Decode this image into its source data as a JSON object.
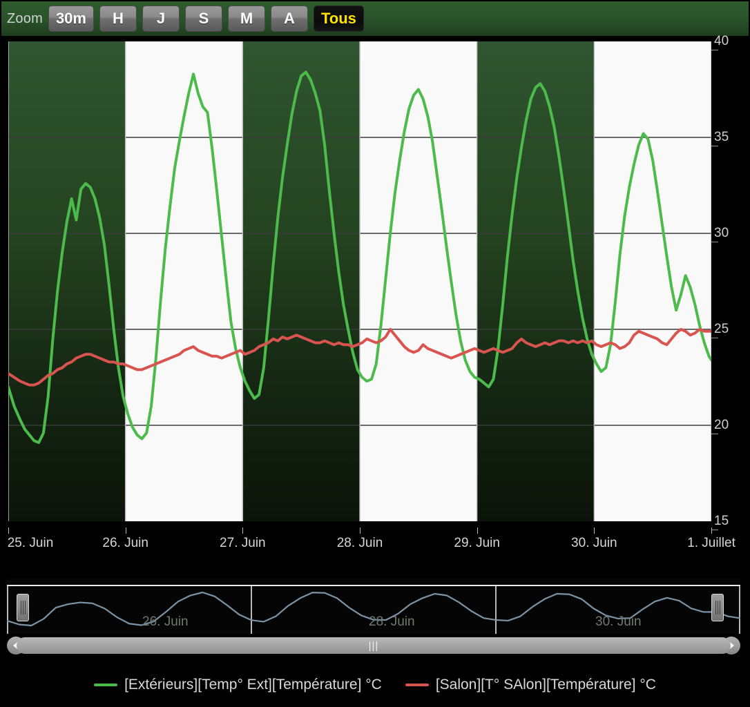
{
  "zoom_bar": {
    "label": "Zoom",
    "buttons": [
      {
        "label": "30m",
        "selected": false
      },
      {
        "label": "H",
        "selected": false
      },
      {
        "label": "J",
        "selected": false
      },
      {
        "label": "S",
        "selected": false
      },
      {
        "label": "M",
        "selected": false
      },
      {
        "label": "A",
        "selected": false
      },
      {
        "label": "Tous",
        "selected": true
      }
    ]
  },
  "navigator": {
    "dates": [
      "26. Juin",
      "28. Juin",
      "30. Juin"
    ],
    "scroll_grip": "|||",
    "left_arrow": "left-arrow-icon",
    "right_arrow": "right-arrow-icon"
  },
  "colors": {
    "series_green": "#4cbb4c",
    "series_red": "#d9534f",
    "band_dark": "#2f5630",
    "band_light": "#f9f9f9",
    "header_green": "#2f5c2f",
    "selected_text": "#ffe400",
    "background": "#000000",
    "navigator_line": "#7d94a6"
  },
  "legend": [
    {
      "label": "[Extérieurs][Temp° Ext][Température] °C",
      "color": "#4cbb4c"
    },
    {
      "label": "[Salon][T° SAlon][Température] °C",
      "color": "#d9534f"
    }
  ],
  "chart_data": {
    "type": "line",
    "title": "",
    "xlabel": "",
    "ylabel": "°C",
    "ylim": [
      15,
      40
    ],
    "yticks": [
      15,
      20,
      25,
      30,
      35,
      40
    ],
    "grid": true,
    "legend_position": "bottom",
    "x_tick_labels": [
      "25. Juin",
      "26. Juin",
      "27. Juin",
      "28. Juin",
      "29. Juin",
      "30. Juin",
      "1. Juillet"
    ],
    "x_range_days": [
      0,
      6
    ],
    "alternating_bands": true,
    "series": [
      {
        "name": "[Extérieurs][Temp° Ext][Température] °C",
        "color": "#4cbb4c",
        "unit": "°C",
        "x": [
          0.0,
          0.05,
          0.1,
          0.14,
          0.18,
          0.22,
          0.26,
          0.3,
          0.34,
          0.38,
          0.42,
          0.46,
          0.5,
          0.54,
          0.58,
          0.62,
          0.66,
          0.7,
          0.74,
          0.78,
          0.82,
          0.86,
          0.9,
          0.94,
          0.98,
          1.02,
          1.06,
          1.1,
          1.14,
          1.18,
          1.22,
          1.26,
          1.3,
          1.34,
          1.38,
          1.42,
          1.46,
          1.5,
          1.54,
          1.58,
          1.62,
          1.66,
          1.7,
          1.74,
          1.78,
          1.82,
          1.86,
          1.9,
          1.94,
          1.98,
          2.02,
          2.06,
          2.1,
          2.14,
          2.18,
          2.22,
          2.26,
          2.3,
          2.34,
          2.38,
          2.42,
          2.46,
          2.5,
          2.54,
          2.58,
          2.62,
          2.66,
          2.7,
          2.74,
          2.78,
          2.82,
          2.86,
          2.9,
          2.94,
          2.98,
          3.02,
          3.06,
          3.1,
          3.14,
          3.18,
          3.22,
          3.26,
          3.3,
          3.34,
          3.38,
          3.42,
          3.46,
          3.5,
          3.54,
          3.58,
          3.62,
          3.66,
          3.7,
          3.74,
          3.78,
          3.82,
          3.86,
          3.9,
          3.94,
          3.98,
          4.02,
          4.06,
          4.1,
          4.14,
          4.18,
          4.22,
          4.26,
          4.3,
          4.34,
          4.38,
          4.42,
          4.46,
          4.5,
          4.54,
          4.58,
          4.62,
          4.66,
          4.7,
          4.74,
          4.78,
          4.82,
          4.86,
          4.9,
          4.94,
          4.98,
          5.02,
          5.06,
          5.1,
          5.14,
          5.18,
          5.22,
          5.26,
          5.3,
          5.34,
          5.38,
          5.42,
          5.46,
          5.5,
          5.54,
          5.58,
          5.62,
          5.66,
          5.7,
          5.74,
          5.78,
          5.82,
          5.86,
          5.9,
          5.94,
          5.98,
          6.0
        ],
        "y": [
          22.0,
          21.0,
          20.3,
          19.8,
          19.5,
          19.2,
          19.1,
          19.6,
          21.5,
          24.5,
          27.0,
          29.0,
          30.6,
          31.8,
          30.7,
          32.3,
          32.6,
          32.4,
          31.8,
          30.8,
          29.4,
          27.3,
          25.0,
          23.0,
          21.5,
          20.6,
          19.9,
          19.5,
          19.3,
          19.6,
          21.0,
          23.5,
          26.5,
          29.2,
          31.4,
          33.4,
          34.8,
          36.1,
          37.3,
          38.3,
          37.3,
          36.6,
          36.3,
          34.4,
          32.2,
          29.9,
          27.6,
          25.4,
          24.0,
          23.0,
          22.3,
          21.8,
          21.4,
          21.6,
          23.0,
          25.5,
          28.3,
          30.8,
          32.9,
          34.6,
          36.2,
          37.4,
          38.2,
          38.4,
          38.0,
          37.3,
          36.4,
          34.6,
          32.2,
          30.0,
          28.0,
          26.3,
          25.0,
          23.8,
          22.9,
          22.5,
          22.3,
          22.4,
          23.2,
          25.2,
          27.6,
          30.0,
          32.1,
          33.8,
          35.3,
          36.5,
          37.2,
          37.5,
          37.0,
          36.1,
          34.8,
          33.0,
          31.2,
          29.3,
          27.5,
          25.8,
          24.4,
          23.4,
          22.8,
          22.5,
          22.4,
          22.2,
          22.0,
          22.4,
          24.0,
          26.3,
          28.8,
          31.0,
          32.9,
          34.5,
          35.9,
          37.0,
          37.6,
          37.8,
          37.4,
          36.6,
          35.5,
          34.0,
          32.3,
          30.5,
          28.6,
          27.0,
          25.6,
          24.5,
          23.7,
          23.2,
          22.8,
          23.0,
          24.2,
          26.4,
          28.9,
          30.9,
          32.4,
          33.6,
          34.6,
          35.2,
          34.9,
          33.8,
          32.2,
          30.5,
          28.8,
          27.2,
          26.0,
          26.8,
          27.8,
          27.2,
          26.3,
          25.2,
          24.3,
          23.6,
          23.4
        ]
      },
      {
        "name": "[Salon][T° SAlon][Température] °C",
        "color": "#d9534f",
        "unit": "°C",
        "x": [
          0.0,
          0.05,
          0.1,
          0.14,
          0.18,
          0.22,
          0.26,
          0.3,
          0.34,
          0.38,
          0.42,
          0.46,
          0.5,
          0.54,
          0.58,
          0.62,
          0.66,
          0.7,
          0.74,
          0.78,
          0.82,
          0.86,
          0.9,
          0.94,
          0.98,
          1.02,
          1.06,
          1.1,
          1.14,
          1.18,
          1.22,
          1.26,
          1.3,
          1.34,
          1.38,
          1.42,
          1.46,
          1.5,
          1.54,
          1.58,
          1.62,
          1.66,
          1.7,
          1.74,
          1.78,
          1.82,
          1.86,
          1.9,
          1.94,
          1.98,
          2.02,
          2.06,
          2.1,
          2.14,
          2.18,
          2.22,
          2.26,
          2.3,
          2.34,
          2.38,
          2.42,
          2.46,
          2.5,
          2.54,
          2.58,
          2.62,
          2.66,
          2.7,
          2.74,
          2.78,
          2.82,
          2.86,
          2.9,
          2.94,
          2.98,
          3.02,
          3.06,
          3.1,
          3.14,
          3.18,
          3.22,
          3.26,
          3.3,
          3.34,
          3.38,
          3.42,
          3.46,
          3.5,
          3.54,
          3.58,
          3.62,
          3.66,
          3.7,
          3.74,
          3.78,
          3.82,
          3.86,
          3.9,
          3.94,
          3.98,
          4.02,
          4.06,
          4.1,
          4.14,
          4.18,
          4.22,
          4.26,
          4.3,
          4.34,
          4.38,
          4.42,
          4.46,
          4.5,
          4.54,
          4.58,
          4.62,
          4.66,
          4.7,
          4.74,
          4.78,
          4.82,
          4.86,
          4.9,
          4.94,
          4.98,
          5.02,
          5.06,
          5.1,
          5.14,
          5.18,
          5.22,
          5.26,
          5.3,
          5.34,
          5.38,
          5.42,
          5.46,
          5.5,
          5.54,
          5.58,
          5.62,
          5.66,
          5.7,
          5.74,
          5.78,
          5.82,
          5.86,
          5.9,
          5.94,
          5.98,
          6.0
        ],
        "y": [
          22.7,
          22.5,
          22.3,
          22.2,
          22.1,
          22.1,
          22.2,
          22.4,
          22.6,
          22.7,
          22.9,
          23.0,
          23.2,
          23.3,
          23.5,
          23.6,
          23.7,
          23.7,
          23.6,
          23.5,
          23.4,
          23.3,
          23.3,
          23.2,
          23.2,
          23.1,
          23.0,
          22.9,
          22.9,
          23.0,
          23.1,
          23.2,
          23.3,
          23.4,
          23.5,
          23.6,
          23.7,
          23.9,
          24.0,
          24.1,
          23.9,
          23.8,
          23.7,
          23.6,
          23.6,
          23.5,
          23.6,
          23.7,
          23.8,
          23.9,
          23.7,
          23.8,
          23.9,
          24.1,
          24.2,
          24.3,
          24.5,
          24.4,
          24.6,
          24.5,
          24.6,
          24.7,
          24.6,
          24.5,
          24.4,
          24.3,
          24.3,
          24.4,
          24.3,
          24.2,
          24.3,
          24.2,
          24.2,
          24.1,
          24.2,
          24.3,
          24.5,
          24.4,
          24.3,
          24.4,
          24.6,
          25.0,
          24.7,
          24.4,
          24.1,
          23.9,
          23.8,
          23.9,
          24.2,
          24.0,
          23.9,
          23.8,
          23.7,
          23.6,
          23.5,
          23.6,
          23.7,
          23.8,
          23.9,
          24.0,
          23.9,
          23.8,
          23.9,
          24.0,
          23.9,
          23.8,
          23.9,
          24.0,
          24.3,
          24.5,
          24.3,
          24.2,
          24.1,
          24.2,
          24.3,
          24.2,
          24.3,
          24.4,
          24.4,
          24.3,
          24.4,
          24.3,
          24.4,
          24.3,
          24.4,
          24.2,
          24.1,
          24.2,
          24.3,
          24.2,
          24.0,
          24.1,
          24.3,
          24.7,
          24.9,
          24.8,
          24.7,
          24.6,
          24.5,
          24.3,
          24.2,
          24.5,
          24.8,
          25.0,
          24.9,
          24.7,
          24.8,
          25.0,
          24.9,
          24.9,
          24.9
        ]
      }
    ],
    "navigator_series": {
      "name": "navigator-overview",
      "color": "#7d94a6",
      "x": [
        0.0,
        0.1,
        0.2,
        0.3,
        0.4,
        0.5,
        0.6,
        0.7,
        0.8,
        0.9,
        1.0,
        1.1,
        1.2,
        1.3,
        1.4,
        1.5,
        1.6,
        1.7,
        1.8,
        1.9,
        2.0,
        2.1,
        2.2,
        2.3,
        2.4,
        2.5,
        2.6,
        2.7,
        2.8,
        2.9,
        3.0,
        3.1,
        3.2,
        3.3,
        3.4,
        3.5,
        3.6,
        3.7,
        3.8,
        3.9,
        4.0,
        4.1,
        4.2,
        4.3,
        4.4,
        4.5,
        4.6,
        4.7,
        4.8,
        4.9,
        5.0,
        5.1,
        5.2,
        5.3,
        5.4,
        5.5,
        5.6,
        5.7,
        5.8,
        5.9,
        6.0
      ],
      "y": [
        22.0,
        19.8,
        19.2,
        23.0,
        29.5,
        31.5,
        32.5,
        32.0,
        29.0,
        24.0,
        20.3,
        19.4,
        21.5,
        27.0,
        33.0,
        36.5,
        38.3,
        36.0,
        31.0,
        25.5,
        22.3,
        21.4,
        24.5,
        30.5,
        35.0,
        38.2,
        38.0,
        35.0,
        29.5,
        25.0,
        22.5,
        22.4,
        26.0,
        31.5,
        35.0,
        37.5,
        36.5,
        32.5,
        27.5,
        23.5,
        22.4,
        22.0,
        24.5,
        30.0,
        34.5,
        37.5,
        37.2,
        34.5,
        29.0,
        25.0,
        23.2,
        23.5,
        28.5,
        33.0,
        35.2,
        33.5,
        29.0,
        27.0,
        27.0,
        24.5,
        23.4
      ]
    }
  }
}
